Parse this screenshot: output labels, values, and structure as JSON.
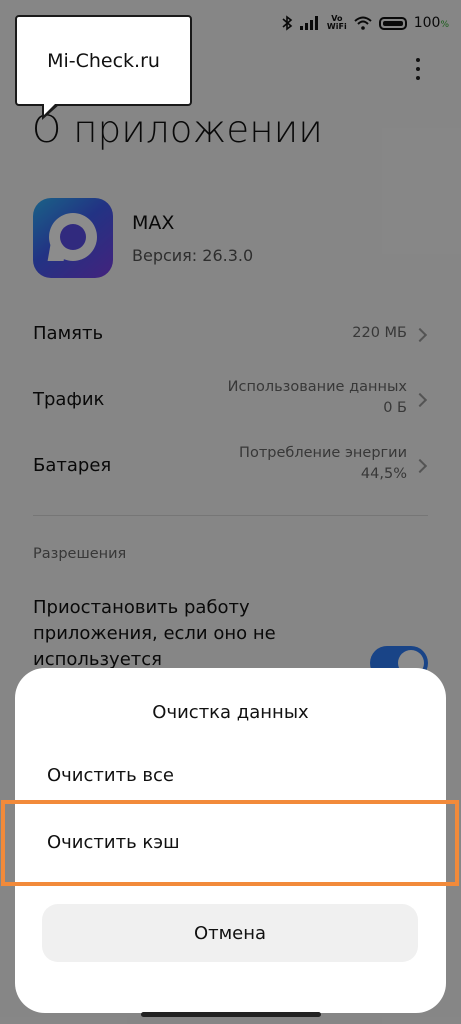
{
  "watermark": {
    "text": "Mi-Check.ru"
  },
  "status_bar": {
    "battery": "100",
    "battery_unit": "%",
    "vowifi_top": "Vo",
    "vowifi_bottom": "WiFi"
  },
  "header": {
    "title": "О приложении"
  },
  "app": {
    "name": "MAX",
    "version": "Версия: 26.3.0"
  },
  "info_rows": [
    {
      "label": "Память",
      "value_line1": "220 МБ",
      "value_line2": ""
    },
    {
      "label": "Трафик",
      "value_line1": "Использование данных",
      "value_line2": "0 Б"
    },
    {
      "label": "Батарея",
      "value_line1": "Потребление энергии",
      "value_line2": "44,5%"
    }
  ],
  "permissions": {
    "header": "Разрешения",
    "pause_app": "Приостановить работу приложения, если оно не используется",
    "pause_app_enabled": true
  },
  "dialog": {
    "title": "Очистка данных",
    "items": [
      "Очистить все",
      "Очистить кэш"
    ],
    "cancel": "Отмена"
  },
  "colors": {
    "accent": "#2f7cf6",
    "highlight": "#f28a3a"
  }
}
